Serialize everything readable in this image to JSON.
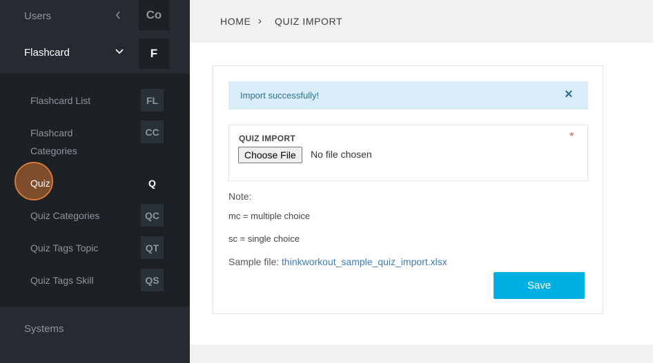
{
  "sidebar": {
    "users": {
      "label": "Users",
      "badge": "Co"
    },
    "flashcard": {
      "label": "Flashcard",
      "badge": "F"
    },
    "sub_items": [
      {
        "label": "Flashcard List",
        "badge": "FL"
      },
      {
        "label_line1": "Flashcard",
        "label_line2": "Categories",
        "badge": "CC"
      },
      {
        "label": "Quiz",
        "badge": "Q"
      },
      {
        "label": "Quiz Categories",
        "badge": "QC"
      },
      {
        "label": "Quiz Tags Topic",
        "badge": "QT"
      },
      {
        "label": "Quiz Tags Skill",
        "badge": "QS"
      }
    ],
    "systems": {
      "label": "Systems"
    }
  },
  "breadcrumb": {
    "home": "HOME",
    "separator": "›",
    "current": "QUIZ IMPORT"
  },
  "alert": {
    "message": "Import successfully!",
    "close": "×"
  },
  "form": {
    "field_label": "QUIZ IMPORT",
    "required_mark": "*",
    "choose_file_label": "Choose File",
    "file_status": "No file chosen"
  },
  "notes": {
    "title": "Note:",
    "line1": "mc = multiple choice",
    "line2": "sc = single choice",
    "sample_label": "Sample file: ",
    "sample_link": "thinkworkout_sample_quiz_import.xlsx"
  },
  "save_label": "Save",
  "colors": {
    "sidebar_bg": "#262b31",
    "submenu_bg": "#1d2126",
    "alert_bg": "#d9edf8",
    "save_bg": "#00b0e4",
    "link": "#3a7cb8",
    "required": "#d9534f"
  }
}
